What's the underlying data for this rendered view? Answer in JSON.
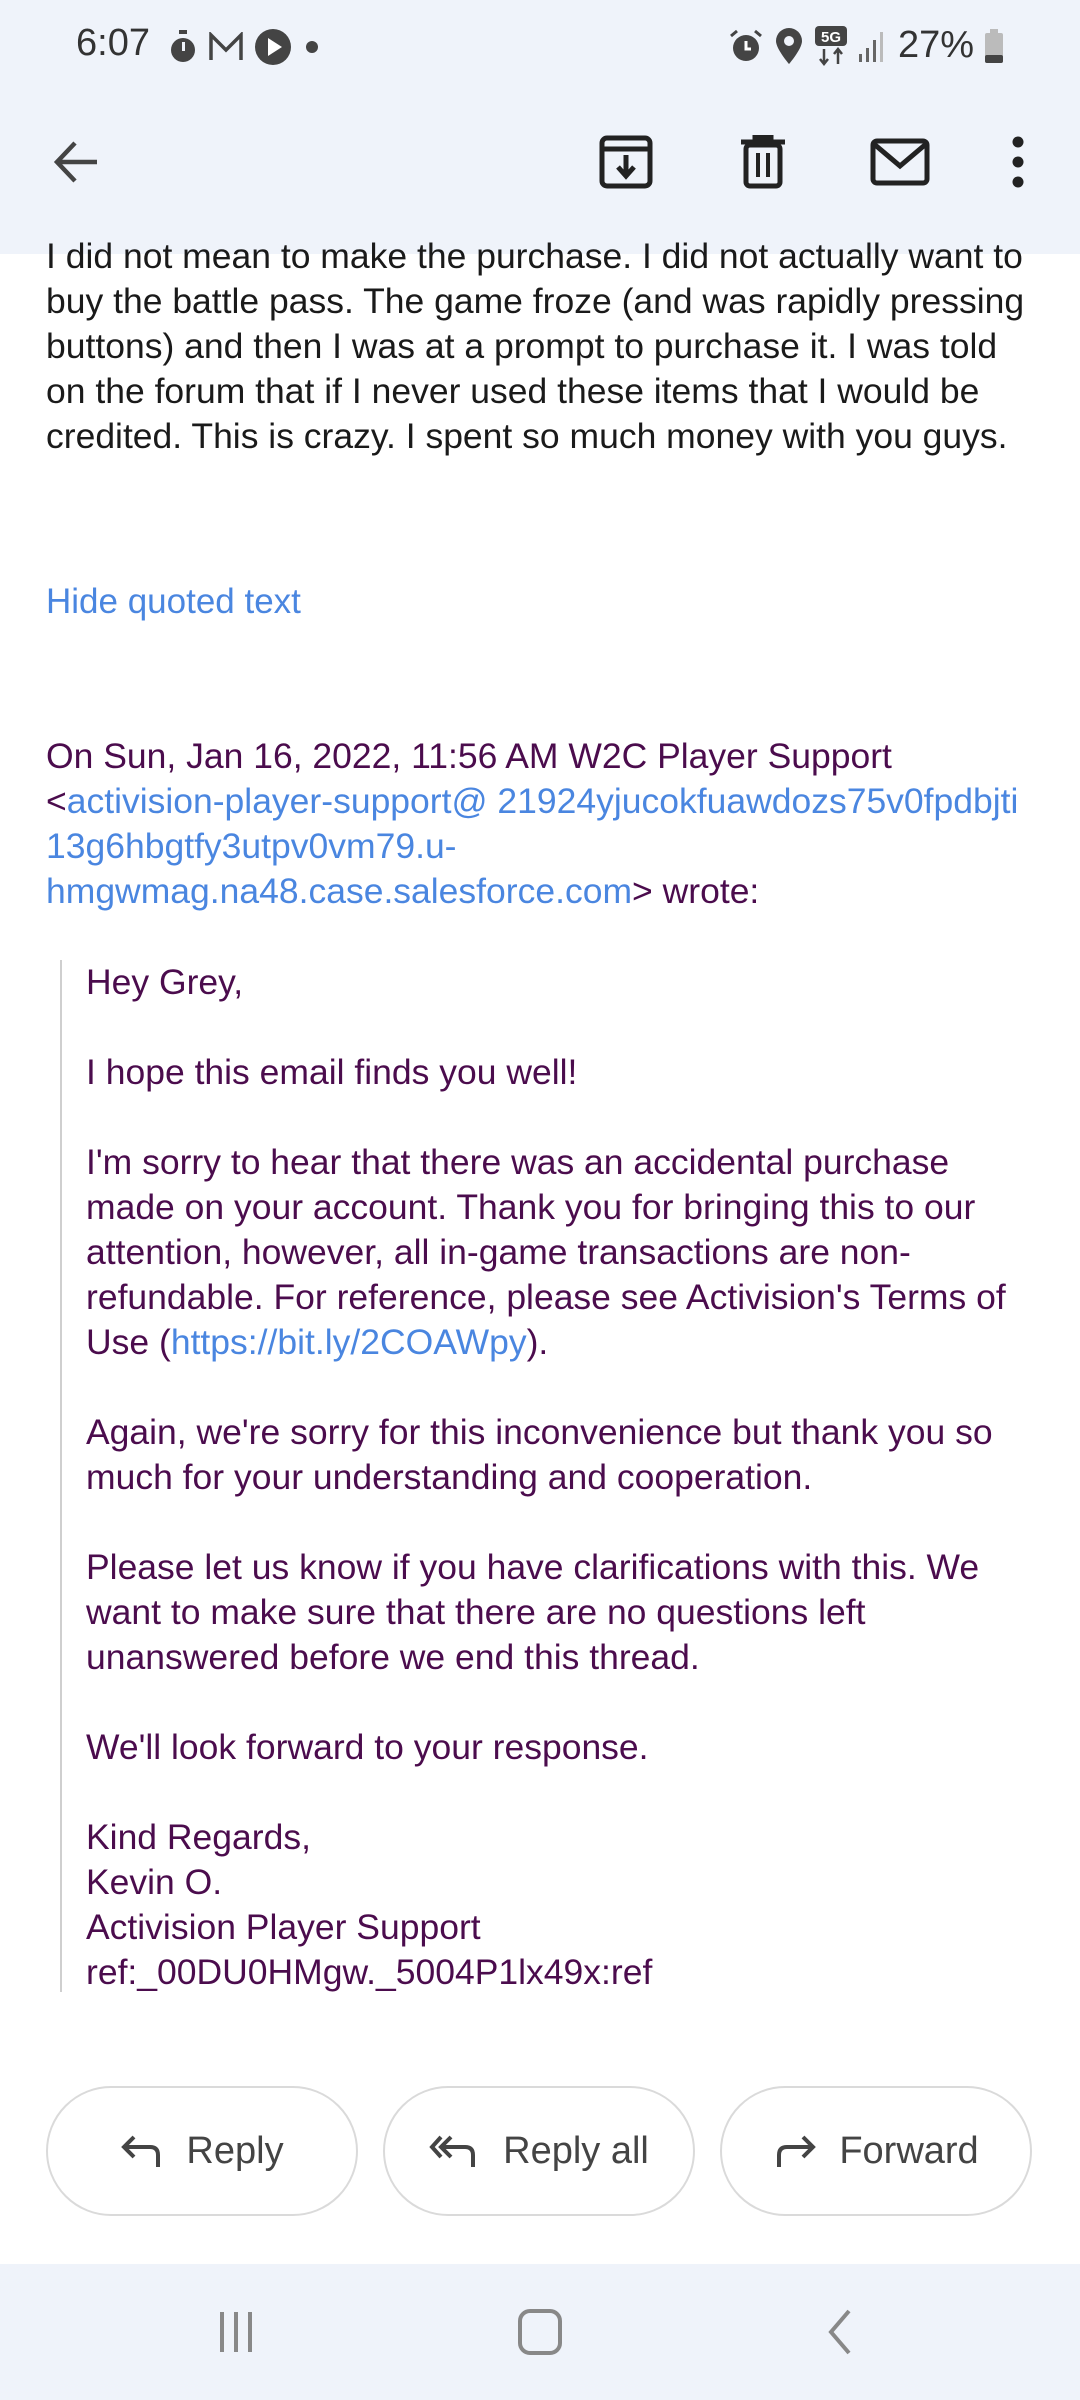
{
  "status_bar": {
    "time": "6:07",
    "left_icons": [
      "timer-icon",
      "gmail-icon",
      "play-icon",
      "dot-icon"
    ],
    "right_icons": [
      "alarm-icon",
      "location-icon",
      "5g-icon",
      "signal-icon"
    ],
    "network": "5G",
    "battery_percent": "27%"
  },
  "toolbar": {
    "back": "back-arrow-icon",
    "actions": [
      "archive",
      "delete",
      "mark-unread",
      "more-options"
    ]
  },
  "message": {
    "body": "I did not mean to make the purchase. I did not actually want to buy the battle pass. The game froze (and was rapidly pressing buttons) and then I was at a  prompt to purchase it. I was told on the forum that if I never used these items that I would be credited. This is crazy. I spent so much money with you guys.",
    "hide_quoted_label": "Hide quoted text"
  },
  "quote": {
    "header_prefix": "On Sun, Jan 16, 2022, 11:56 AM W2C Player Support <",
    "sender_email": "activision-player-support@ 21924yjucokfuawdozs75v0fpdbjti 13g6hbgtfy3utpv0vm79.u-hmgwmag.na48.case.salesforce.com",
    "header_suffix": "> wrote:",
    "greeting": "Hey Grey,",
    "p1": "I hope this email finds you well!",
    "p2_before_link": "I'm sorry to hear that there was an accidental purchase made on your account. Thank you for bringing this to our attention, however, all in-game transactions are non-refundable. For reference, please see Activision's Terms of Use (",
    "p2_link": "https://bit.ly/2COAWpy",
    "p2_after_link": ").",
    "p3": "Again, we're sorry for this inconvenience but thank you so much for your understanding and cooperation.",
    "p4": "Please let us know if you have clarifications with this. We want to make sure that there are no questions left unanswered before we end this thread.",
    "p5": "We'll look forward to your response.",
    "sign_off": "Kind Regards,",
    "signer_name": "Kevin O.",
    "signer_team": "Activision Player Support",
    "ref": "ref:_00DU0HMgw._5004P1lx49x:ref"
  },
  "actions": {
    "reply": "Reply",
    "reply_all": "Reply all",
    "forward": "Forward"
  },
  "nav_bar": {
    "buttons": [
      "recent-apps",
      "home",
      "back"
    ]
  },
  "colors": {
    "bar_bg": "#eff3fa",
    "link": "#4a86e0",
    "quoted_text": "#4b0c4d",
    "body_text": "#1a1a1a"
  }
}
